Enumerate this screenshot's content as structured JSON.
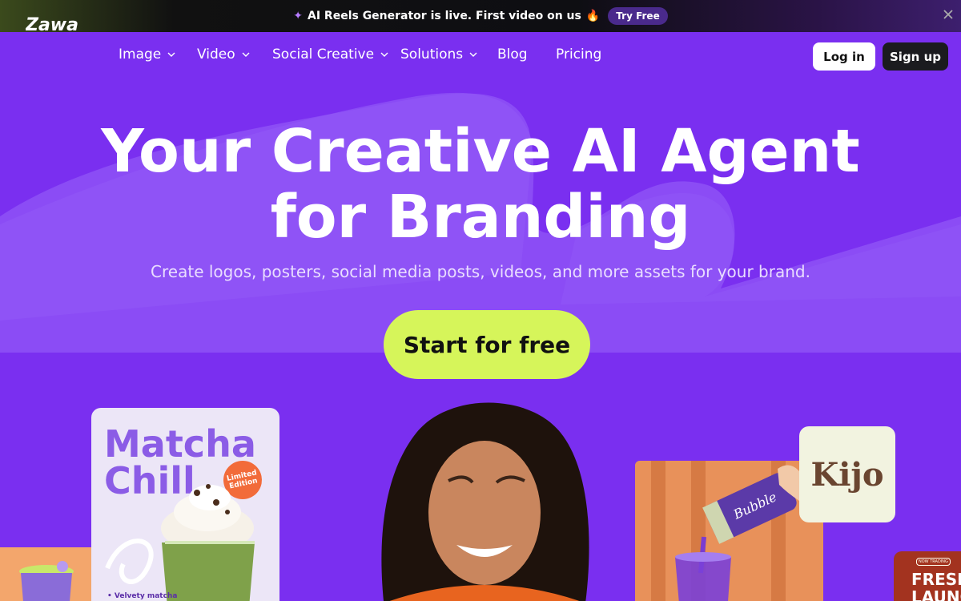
{
  "announcement": {
    "text": "AI Reels Generator is live. First video on us",
    "cta_label": "Try Free"
  },
  "nav": {
    "logo": "Zawa",
    "items": [
      {
        "label": "Image",
        "has_dropdown": true
      },
      {
        "label": "Video",
        "has_dropdown": true
      },
      {
        "label": "Social Creative",
        "has_dropdown": true
      },
      {
        "label": "Solutions",
        "has_dropdown": true
      },
      {
        "label": "Blog",
        "has_dropdown": false
      },
      {
        "label": "Pricing",
        "has_dropdown": false
      }
    ],
    "login_label": "Log in",
    "signup_label": "Sign up"
  },
  "hero": {
    "headline_line1": "Your Creative AI Agent",
    "headline_line2": "for Branding",
    "subheadline": "Create logos, posters, social media posts, videos, and more assets for your brand.",
    "cta_label": "Start for free"
  },
  "cards": {
    "matcha": {
      "title_line1": "Matcha",
      "title_line2": "Chill",
      "badge": "Limited Edition",
      "footer": "• Velvety matcha"
    },
    "bubble_can_label": "Bubble",
    "kijo": "Kijo",
    "fresh": {
      "small": "NOW TRADING",
      "line1": "FRESH",
      "line2": "LAUNCH"
    }
  },
  "colors": {
    "brand_purple": "#7a2ff0",
    "cta_green": "#d6f55a",
    "dark": "#1b1b1f"
  }
}
